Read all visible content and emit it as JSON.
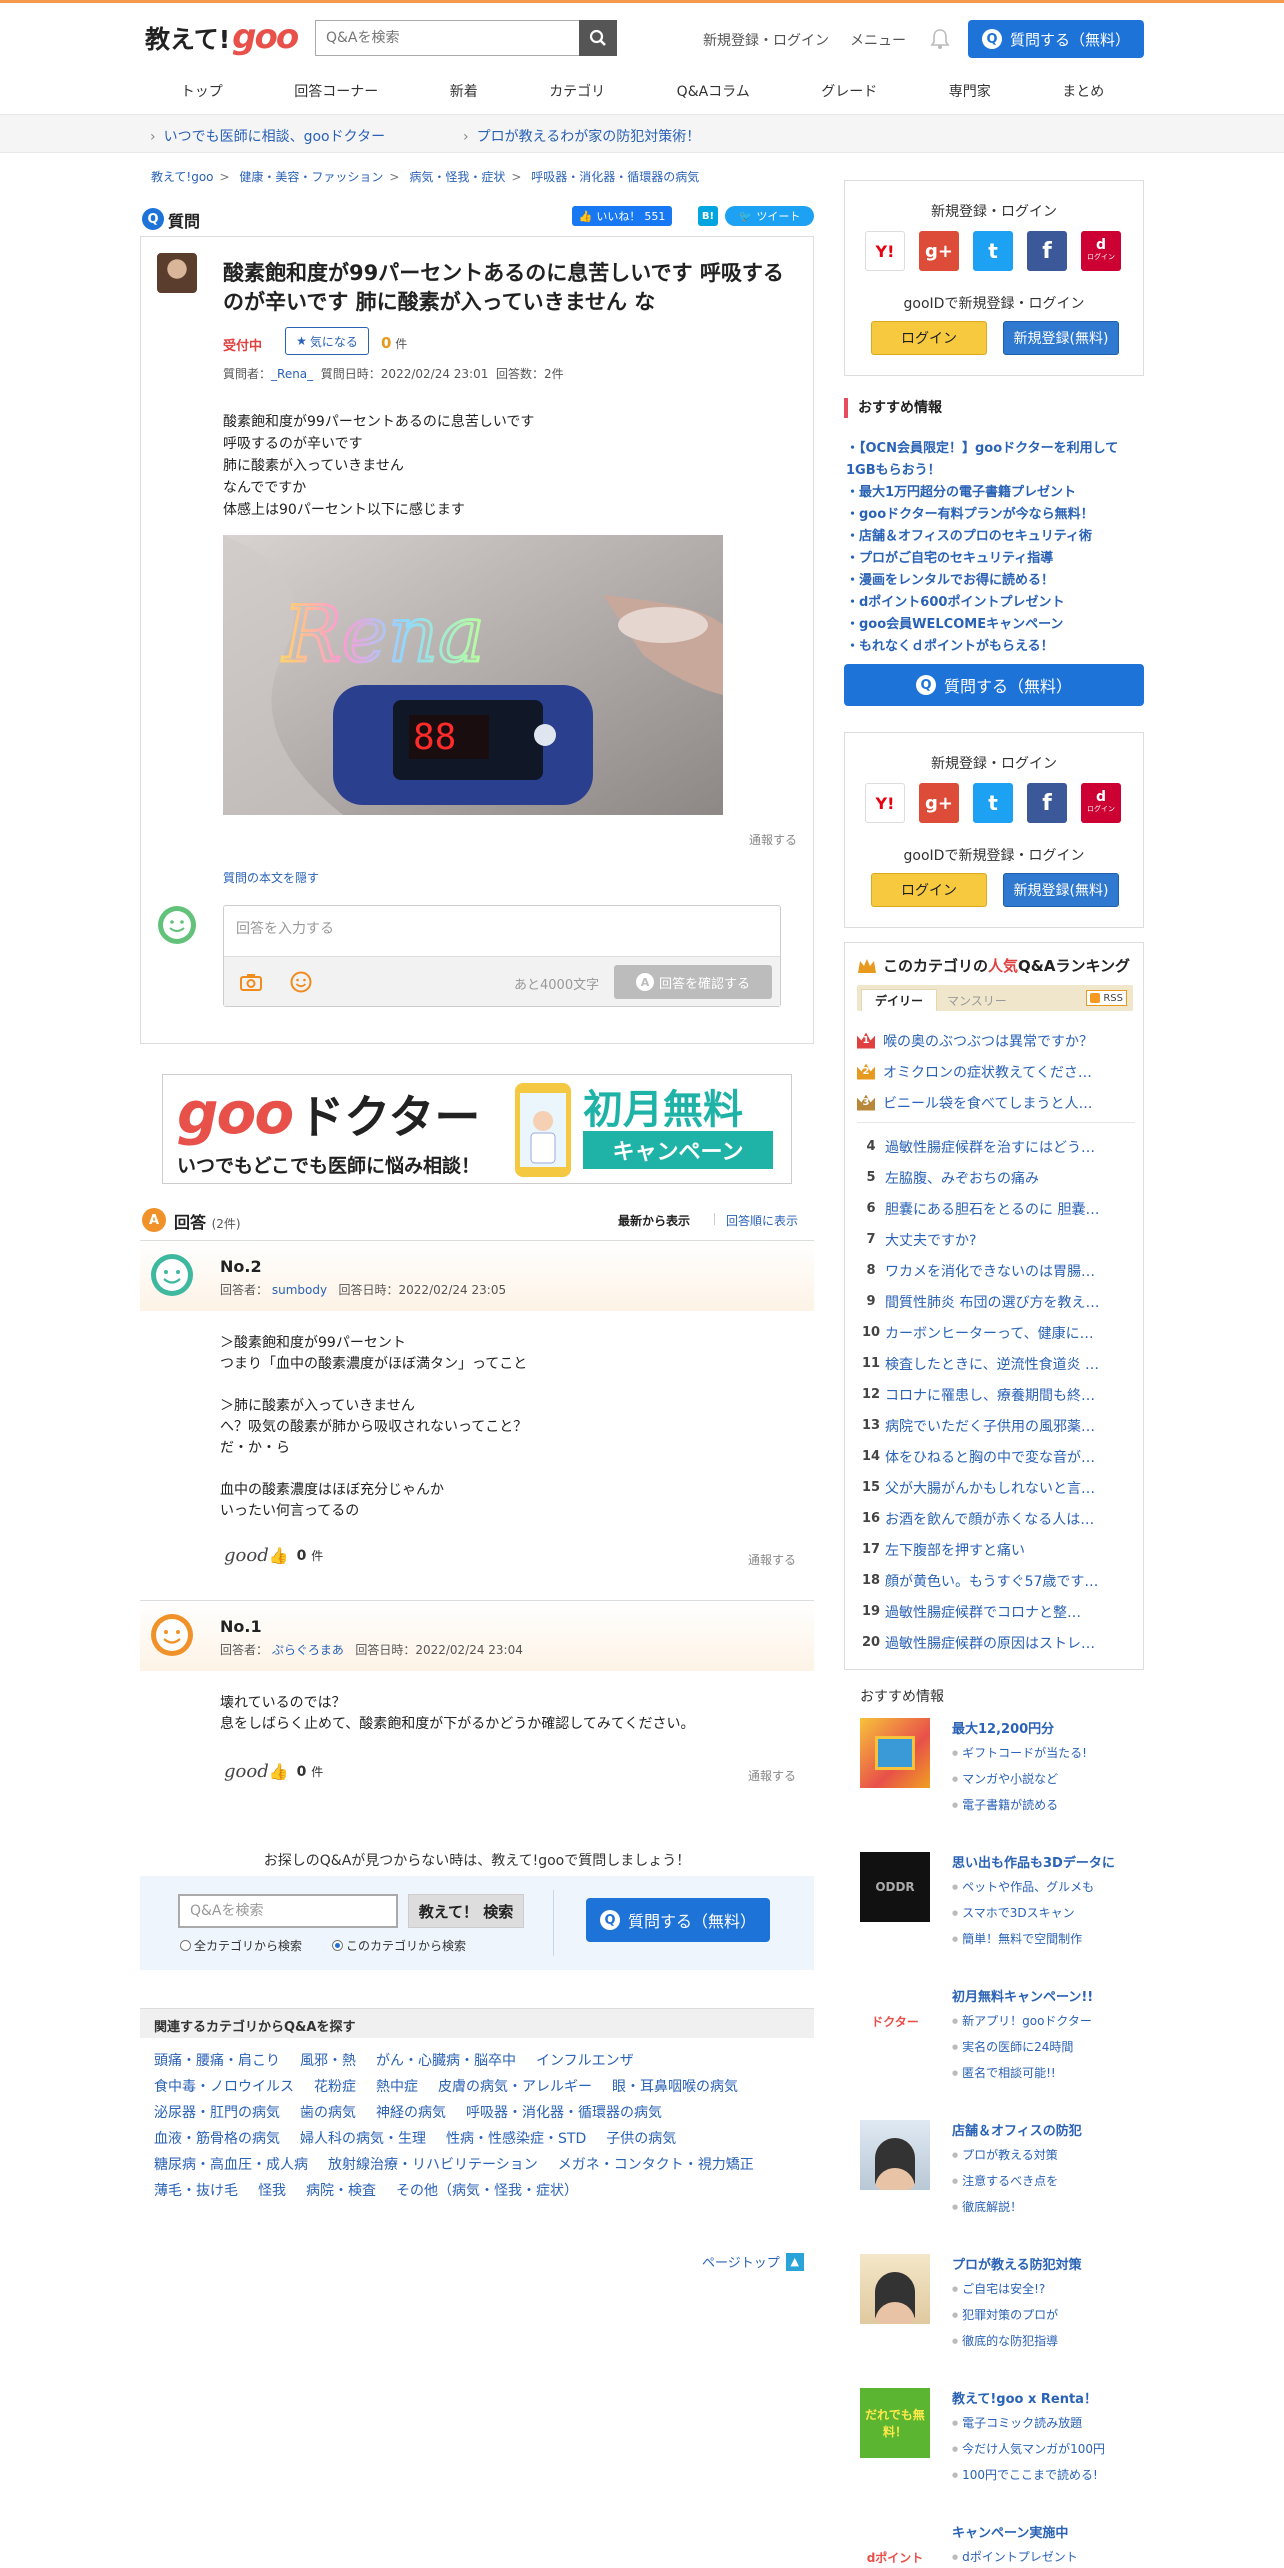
{
  "header": {
    "logo_text": "教えて!",
    "logo_brand": "goo",
    "search_placeholder": "Q&Aを検索",
    "register_login": "新規登録・ログイン",
    "menu": "メニュー",
    "ask_button": "質問する（無料）"
  },
  "nav": [
    "トップ",
    "回答コーナー",
    "新着",
    "カテゴリ",
    "Q&Aコラム",
    "グレード",
    "専門家",
    "まとめ"
  ],
  "subnav": [
    "いつでも医師に相談、gooドクター",
    "プロが教えるわが家の防犯対策術！"
  ],
  "breadcrumb": [
    "教えて!goo",
    "健康・美容・ファッション",
    "病気・怪我・症状",
    "呼吸器・消化器・循環器の病気"
  ],
  "question": {
    "label": "質問",
    "like_label": "いいね！",
    "like_count": "551",
    "hatena": "B!",
    "tweet": "ツイート",
    "title": "酸素飽和度が99パーセントあるのに息苦しいです 呼吸するのが辛いです 肺に酸素が入っていきません な",
    "status": "受付中",
    "fav_label": "気になる",
    "fav_count": "0",
    "fav_unit": "件",
    "meta_asker_label": "質問者：",
    "meta_asker": "_Rena_",
    "meta_date": "質問日時：2022/02/24 23:01",
    "meta_answers": "回答数：2件",
    "body": [
      "酸素飽和度が99パーセントあるのに息苦しいです",
      "呼吸するのが辛いです",
      "肺に酸素が入っていきません",
      "なんでですか",
      "体感上は90パーセント以下に感じます"
    ],
    "image_overlay": "Rena",
    "report": "通報する",
    "hide_body": "質問の本文を隠す",
    "answer_placeholder": "回答を入力する",
    "char_limit": "あと4000文字",
    "confirm_button": "回答を確認する"
  },
  "banner": {
    "brand": "goo",
    "doctor": "ドクター",
    "tagline": "いつでもどこでも医師に悩み相談！",
    "promo": "初月無料",
    "campaign": "キャンペーン"
  },
  "answers_section": {
    "label": "回答",
    "count": "(2件)",
    "sort_new": "最新から表示",
    "sort_old": "回答順に表示"
  },
  "answers": [
    {
      "no": "No.2",
      "answerer_label": "回答者：",
      "answerer": "sumbody",
      "date": "回答日時：2022/02/24 23:05",
      "body": [
        "＞酸素飽和度が99パーセント",
        "つまり「血中の酸素濃度がほぼ満タン」ってこと",
        "",
        "＞肺に酸素が入っていきません",
        "へ？吸気の酸素が肺から吸収されないってこと？",
        "だ・か・ら",
        "",
        "血中の酸素濃度はほぼ充分じゃんか",
        "いったい何言ってるの"
      ],
      "good_label": "good",
      "good_count": "0",
      "good_unit": "件",
      "report": "通報する"
    },
    {
      "no": "No.1",
      "answerer_label": "回答者：",
      "answerer": "ぷらぐろまあ",
      "date": "回答日時：2022/02/24 23:04",
      "body": [
        "壊れているのでは？",
        "息をしばらく止めて、酸素飽和度が下がるかどうか確認してみてください。"
      ],
      "good_label": "good",
      "good_count": "0",
      "good_unit": "件",
      "report": "通報する"
    }
  ],
  "bottom_search": {
    "prompt": "お探しのQ&Aが見つからない時は、教えて!gooで質問しましょう！",
    "placeholder": "Q&Aを検索",
    "button": "教えて！ 検索",
    "radio_all": "全カテゴリから検索",
    "radio_this": "このカテゴリから検索",
    "ask_button": "質問する（無料）"
  },
  "related": {
    "title": "関連するカテゴリからQ&Aを探す",
    "items": [
      "頭痛・腰痛・肩こり",
      "風邪・熱",
      "がん・心臓病・脳卒中",
      "インフルエンザ",
      "食中毒・ノロウイルス",
      "花粉症",
      "熱中症",
      "皮膚の病気・アレルギー",
      "眼・耳鼻咽喉の病気",
      "泌尿器・肛門の病気",
      "歯の病気",
      "神経の病気",
      "呼吸器・消化器・循環器の病気",
      "血液・筋骨格の病気",
      "婦人科の病気・生理",
      "性病・性感染症・STD",
      "子供の病気",
      "糖尿病・高血圧・成人病",
      "放射線治療・リハビリテーション",
      "メガネ・コンタクト・視力矯正",
      "薄毛・抜け毛",
      "怪我",
      "病院・検査",
      "その他（病気・怪我・症状）"
    ]
  },
  "pagetop": "ページトップ",
  "sidebar": {
    "login_title": "新規登録・ログイン",
    "login_sub": "gooIDで新規登録・ログイン",
    "login_button": "ログイン",
    "register_button": "新規登録(無料)",
    "sns": [
      {
        "name": "yahoo",
        "label": "Y!",
        "color": "#ffffff"
      },
      {
        "name": "google",
        "label": "g+",
        "color": "#dd4b39"
      },
      {
        "name": "twitter",
        "label": "t",
        "color": "#1da1f2"
      },
      {
        "name": "facebook",
        "label": "f",
        "color": "#3b5998"
      },
      {
        "name": "docomo",
        "label": "d",
        "color": "#cc0033"
      }
    ],
    "docomo_caption": "ログイン",
    "recommend_title": "おすすめ情報",
    "recommend_items": [
      "・【OCN会員限定！】gooドクターを利用して1GBもらおう！",
      "・最大1万円超分の電子書籍プレゼント",
      "・gooドクター有料プランが今なら無料！",
      "・店舗＆オフィスのプロのセキュリティ術",
      "・プロがご自宅のセキュリティ指導",
      "・漫画をレンタルでお得に読める！",
      "・dポイント600ポイントプレゼント",
      "・goo会員WELCOMEキャンペーン",
      "・もれなくｄポイントがもらえる！"
    ],
    "ask_button": "質問する（無料）",
    "ranking_title_prefix": "このカテゴリの",
    "ranking_title_pop": "人気",
    "ranking_title_suffix": "Q&Aランキング",
    "tab_daily": "デイリー",
    "tab_monthly": "マンスリー",
    "rss": "RSS",
    "ranking": [
      {
        "no": "1",
        "text": "喉の奥のぶつぶつは異常ですか？"
      },
      {
        "no": "2",
        "text": "オミクロンの症状教えてくださ…"
      },
      {
        "no": "3",
        "text": "ビニール袋を食べてしまうと人…"
      },
      {
        "no": "4",
        "text": "過敏性腸症候群を治すにはどう…"
      },
      {
        "no": "5",
        "text": "左脇腹、みぞおちの痛み"
      },
      {
        "no": "6",
        "text": "胆嚢にある胆石をとるのに 胆嚢…"
      },
      {
        "no": "7",
        "text": "大丈夫ですか?"
      },
      {
        "no": "8",
        "text": "ワカメを消化できないのは胃腸…"
      },
      {
        "no": "9",
        "text": "間質性肺炎 布団の選び方を教え…"
      },
      {
        "no": "10",
        "text": "カーボンヒーターって、健康に…"
      },
      {
        "no": "11",
        "text": "検査したときに、逆流性食道炎 …"
      },
      {
        "no": "12",
        "text": "コロナに罹患し、療養期間も終…"
      },
      {
        "no": "13",
        "text": "病院でいただく子供用の風邪薬…"
      },
      {
        "no": "14",
        "text": "体をひねると胸の中で変な音が…"
      },
      {
        "no": "15",
        "text": "父が大腸がんかもしれないと言…"
      },
      {
        "no": "16",
        "text": "お酒を飲んで顔が赤くなる人は…"
      },
      {
        "no": "17",
        "text": "左下腹部を押すと痛い"
      },
      {
        "no": "18",
        "text": "顔が黄色い。もうすぐ57歳です…"
      },
      {
        "no": "19",
        "text": "過敏性腸症候群でコロナと整…"
      },
      {
        "no": "20",
        "text": "過敏性腸症候群の原因はストレ…"
      }
    ],
    "rec2_title": "おすすめ情報",
    "rec2": [
      {
        "head": "最大12,200円分",
        "subs": [
          "ギフトコードが当たる!",
          "マンガや小説など",
          "電子書籍が読める"
        ],
        "thumb_text": ""
      },
      {
        "head": "思い出も作品も3Dデータに",
        "subs": [
          "ペットや作品、グルメも",
          "スマホで3Dスキャン",
          "簡単！無料で空間制作"
        ],
        "thumb_text": "ODDR"
      },
      {
        "head": "初月無料キャンペーン!!",
        "subs": [
          "新アプリ！gooドクター",
          "実名の医師に24時間",
          "匿名で相談可能!!"
        ],
        "thumb_text": "ドクター"
      },
      {
        "head": "店舗＆オフィスの防犯",
        "subs": [
          "プロが教える対策",
          "注意するべき点を",
          "徹底解説！"
        ],
        "thumb_text": ""
      },
      {
        "head": "プロが教える防犯対策",
        "subs": [
          "ご自宅は安全!?",
          "犯罪対策のプロが",
          "徹底的な防犯指導"
        ],
        "thumb_text": ""
      },
      {
        "head": "教えて!goo x Renta！",
        "subs": [
          "電子コミック読み放題",
          "今だけ人気マンガが100円",
          "100円でここまで読める!"
        ],
        "thumb_text": "だれでも無料！"
      },
      {
        "head": "キャンペーン実施中",
        "subs": [
          "dポイントプレゼント"
        ],
        "thumb_text": "dポイント"
      }
    ]
  }
}
